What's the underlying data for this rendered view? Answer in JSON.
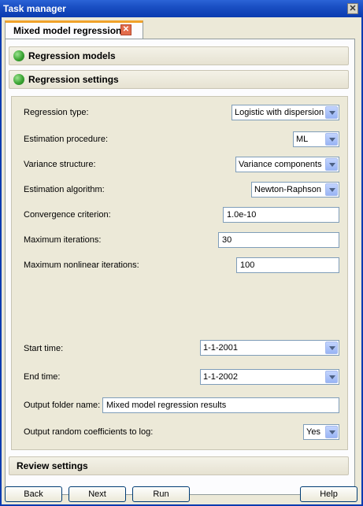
{
  "window": {
    "title": "Task manager",
    "close_glyph": "✕"
  },
  "tab": {
    "label": "Mixed model regression",
    "close_glyph": "✕"
  },
  "sections": {
    "regression_models": "Regression models",
    "regression_settings": "Regression settings",
    "review_settings": "Review settings"
  },
  "form": {
    "regression_type": {
      "label": "Regression type:",
      "value": "Logistic with dispersion"
    },
    "estimation_procedure": {
      "label": "Estimation procedure:",
      "value": "ML"
    },
    "variance_structure": {
      "label": "Variance structure:",
      "value": "Variance components"
    },
    "estimation_algorithm": {
      "label": "Estimation algorithm:",
      "value": "Newton-Raphson"
    },
    "convergence_criterion": {
      "label": "Convergence criterion:",
      "value": "1.0e-10"
    },
    "maximum_iterations": {
      "label": "Maximum iterations:",
      "value": "30"
    },
    "maximum_nonlinear_iterations": {
      "label": "Maximum nonlinear iterations:",
      "value": "100"
    },
    "start_time": {
      "label": "Start time:",
      "value": "1-1-2001"
    },
    "end_time": {
      "label": "End time:",
      "value": "1-1-2002"
    },
    "output_folder_name": {
      "label": "Output folder name:",
      "value": "Mixed model regression results"
    },
    "output_random_coefficients": {
      "label": "Output random coefficients to log:",
      "value": "Yes"
    }
  },
  "buttons": {
    "back": "Back",
    "next": "Next",
    "run": "Run",
    "help": "Help"
  },
  "colors": {
    "title_bar": "#0a3bb0",
    "tab_accent": "#f0a22a",
    "status_dot": "#3ba433"
  }
}
